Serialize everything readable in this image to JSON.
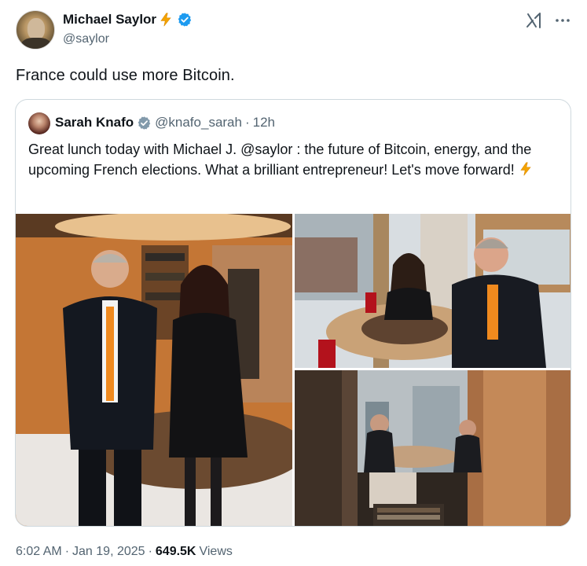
{
  "author": {
    "display_name": "Michael Saylor",
    "handle": "@saylor",
    "badge_emoji": "lightning-bolt",
    "verified": true
  },
  "post": {
    "text": "France could use more Bitcoin."
  },
  "quote": {
    "display_name": "Sarah Knafo",
    "handle": "@knafo_sarah",
    "separator": "·",
    "time": "12h",
    "verified": true,
    "text": "Great lunch today with Michael J. @saylor : the future of Bitcoin, energy, and the upcoming French elections. What a brilliant entrepreneur! Let's move forward! ",
    "media_count": 3
  },
  "footer": {
    "time": "6:02 AM",
    "dot1": "·",
    "date": "Jan 19, 2025",
    "dot2": "·",
    "views_count": "649.5K",
    "views_label": "Views"
  },
  "colors": {
    "text_primary": "#0f1419",
    "text_secondary": "#536471",
    "verified_blue": "#1d9bf0",
    "border": "#cfd9de",
    "bolt": "#f4a300"
  },
  "icons": {
    "grok": "grok-icon",
    "more": "more-icon"
  }
}
